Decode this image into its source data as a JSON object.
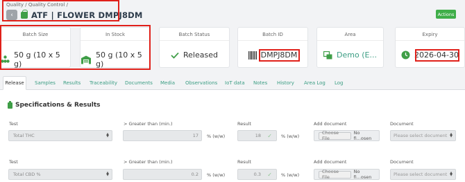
{
  "header": {
    "breadcrumb": "Quality / Quality Control /",
    "back_icon": "chevron-left-icon",
    "title": "ATF | FLOWER DMPJ8DM",
    "actions_label": "Actions"
  },
  "cards": [
    {
      "label": "Batch Size",
      "value": "50 g (10 x 5 g)",
      "icon": "cannabis-leaf-icon"
    },
    {
      "label": "In Stock",
      "value": "50 g (10 x 5 g)",
      "icon": "warehouse-icon"
    },
    {
      "label": "Batch Status",
      "value": "Released",
      "icon": "check-icon"
    },
    {
      "label": "Batch ID",
      "value": "DMPJ8DM",
      "icon": "barcode-icon"
    },
    {
      "label": "Area",
      "value": "Demo (E...",
      "icon": "area-icon"
    },
    {
      "label": "Expiry",
      "value": "2026-04-30",
      "icon": "clock-icon"
    }
  ],
  "tabs": [
    "Release",
    "Samples",
    "Results",
    "Traceability",
    "Documents",
    "Media",
    "Observations",
    "IoT data",
    "Notes",
    "History",
    "Area Log",
    "Log"
  ],
  "section": {
    "title": "Specifications & Results"
  },
  "rows": [
    {
      "test_label": "Test",
      "test_value": "Total THC",
      "min_label": "> Greater than (min.)",
      "min_value": "17",
      "min_unit": "% (w/w)",
      "result_label": "Result",
      "result_value": "18",
      "result_unit": "% (w/w)",
      "add_doc_label": "Add document",
      "choose_label": "Choose File",
      "file_value": "No fi...osen",
      "doc_label": "Document",
      "doc_placeholder": "Please select document"
    },
    {
      "test_label": "Test",
      "test_value": "Total CBD %",
      "min_label": "> Greater than (min.)",
      "min_value": "0.2",
      "min_unit": "% (w/w)",
      "result_label": "Result",
      "result_value": "0.3",
      "result_unit": "% (w/w)",
      "add_doc_label": "Add document",
      "choose_label": "Choose File",
      "file_value": "No fi...osen",
      "doc_label": "Document",
      "doc_placeholder": "Please select document"
    }
  ],
  "colors": {
    "accent": "#3fae49",
    "tab_link": "#3b9d83",
    "highlight": "#e0201a"
  }
}
